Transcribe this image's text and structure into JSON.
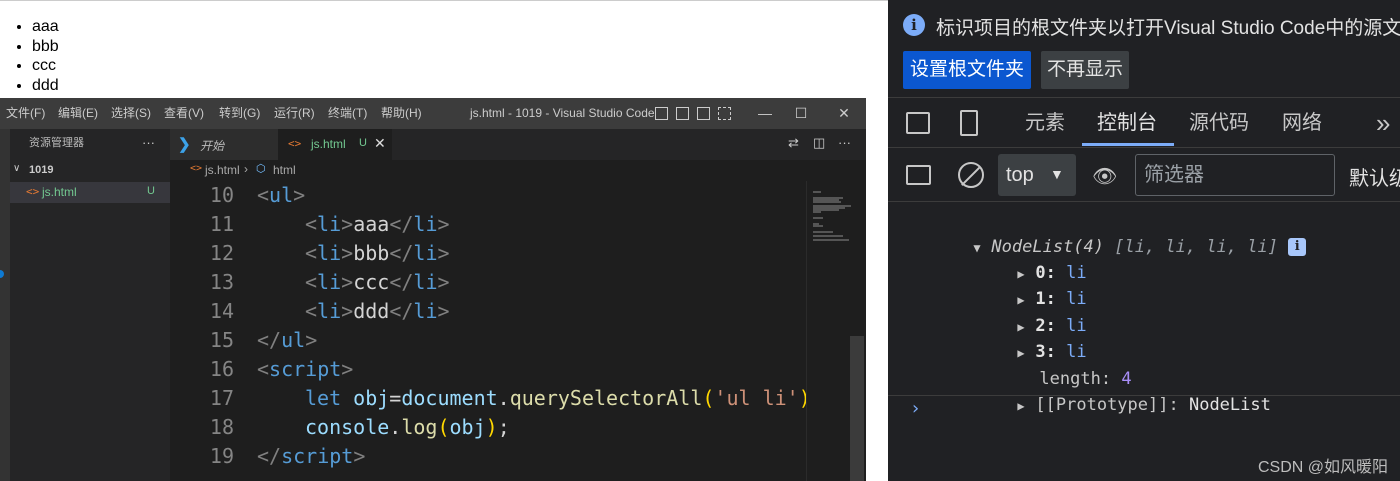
{
  "page_output": {
    "list_items": [
      "aaa",
      "bbb",
      "ccc",
      "ddd"
    ]
  },
  "vscode": {
    "menu": [
      "文件(F)",
      "编辑(E)",
      "选择(S)",
      "查看(V)",
      "转到(G)",
      "运行(R)",
      "终端(T)",
      "帮助(H)"
    ],
    "window_title": "js.html - 1019 - Visual Studio Code",
    "window_controls": {
      "minimize": "—",
      "maximize": "☐",
      "close": "✕"
    },
    "sidebar": {
      "title": "资源管理器",
      "more": "···",
      "folder": "1019",
      "file_icon": "<>",
      "file_name": "js.html",
      "file_status": "U"
    },
    "tabs": {
      "start_label": "开始",
      "active_icon": "<>",
      "active_label": "js.html",
      "active_status": "U",
      "close": "✕"
    },
    "breadcrumb": {
      "icon": "<>",
      "file": "js.html",
      "sep": "›",
      "node": "html"
    },
    "code_lines": [
      {
        "n": "10",
        "indent": 0,
        "tokens": [
          [
            "t-punc",
            "<"
          ],
          [
            "t-tag",
            "ul"
          ],
          [
            "t-punc",
            ">"
          ]
        ]
      },
      {
        "n": "11",
        "indent": 1,
        "tokens": [
          [
            "t-punc",
            "<"
          ],
          [
            "t-tag",
            "li"
          ],
          [
            "t-punc",
            ">"
          ],
          [
            "t-text",
            "aaa"
          ],
          [
            "t-punc",
            "</"
          ],
          [
            "t-tag",
            "li"
          ],
          [
            "t-punc",
            ">"
          ]
        ]
      },
      {
        "n": "12",
        "indent": 1,
        "tokens": [
          [
            "t-punc",
            "<"
          ],
          [
            "t-tag",
            "li"
          ],
          [
            "t-punc",
            ">"
          ],
          [
            "t-text",
            "bbb"
          ],
          [
            "t-punc",
            "</"
          ],
          [
            "t-tag",
            "li"
          ],
          [
            "t-punc",
            ">"
          ]
        ]
      },
      {
        "n": "13",
        "indent": 1,
        "tokens": [
          [
            "t-punc",
            "<"
          ],
          [
            "t-tag",
            "li"
          ],
          [
            "t-punc",
            ">"
          ],
          [
            "t-text",
            "ccc"
          ],
          [
            "t-punc",
            "</"
          ],
          [
            "t-tag",
            "li"
          ],
          [
            "t-punc",
            ">"
          ]
        ]
      },
      {
        "n": "14",
        "indent": 1,
        "tokens": [
          [
            "t-punc",
            "<"
          ],
          [
            "t-tag",
            "li"
          ],
          [
            "t-punc",
            ">"
          ],
          [
            "t-text",
            "ddd"
          ],
          [
            "t-punc",
            "</"
          ],
          [
            "t-tag",
            "li"
          ],
          [
            "t-punc",
            ">"
          ]
        ]
      },
      {
        "n": "15",
        "indent": 0,
        "tokens": [
          [
            "t-punc",
            "</"
          ],
          [
            "t-tag",
            "ul"
          ],
          [
            "t-punc",
            ">"
          ]
        ]
      },
      {
        "n": "16",
        "indent": 0,
        "tokens": [
          [
            "t-punc",
            "<"
          ],
          [
            "t-tag",
            "script"
          ],
          [
            "t-punc",
            ">"
          ]
        ]
      },
      {
        "n": "17",
        "indent": 1,
        "tokens": [
          [
            "t-kw",
            "let"
          ],
          [
            "t-text",
            " "
          ],
          [
            "t-var",
            "obj"
          ],
          [
            "t-text",
            "="
          ],
          [
            "t-var",
            "document"
          ],
          [
            "t-text",
            "."
          ],
          [
            "t-fn",
            "querySelectorAll"
          ],
          [
            "t-brk",
            "("
          ],
          [
            "t-str",
            "'ul li'"
          ],
          [
            "t-brk",
            ")"
          ]
        ]
      },
      {
        "n": "18",
        "indent": 1,
        "tokens": [
          [
            "t-var",
            "console"
          ],
          [
            "t-text",
            "."
          ],
          [
            "t-fn",
            "log"
          ],
          [
            "t-brk",
            "("
          ],
          [
            "t-var",
            "obj"
          ],
          [
            "t-brk",
            ")"
          ],
          [
            "t-text",
            ";"
          ]
        ]
      },
      {
        "n": "19",
        "indent": 0,
        "tokens": [
          [
            "t-punc",
            "</"
          ],
          [
            "t-tag",
            "script"
          ],
          [
            "t-punc",
            ">"
          ]
        ]
      }
    ]
  },
  "devtools": {
    "info_icon": "i",
    "info_text": "标识项目的根文件夹以打开Visual Studio Code中的源文",
    "btn_set_root": "设置根文件夹",
    "btn_dont_show": "不再显示",
    "tabs": [
      "元素",
      "控制台",
      "源代码",
      "网络"
    ],
    "more_tabs": "»",
    "context": "top",
    "context_caret": "▼",
    "filter_placeholder": "筛选器",
    "default_levels": "默认级别",
    "console": {
      "nodelist_head": "NodeList(4) ",
      "nodelist_items": "[li, li, li, li]",
      "info_badge": "i",
      "entries": [
        {
          "key": "0",
          "val": "li"
        },
        {
          "key": "1",
          "val": "li"
        },
        {
          "key": "2",
          "val": "li"
        },
        {
          "key": "3",
          "val": "li"
        }
      ],
      "length_key": "length",
      "length_val": "4",
      "proto_key": "[[Prototype]]",
      "proto_val": "NodeList",
      "prompt": "›"
    }
  },
  "watermark": "CSDN @如风暖阳"
}
